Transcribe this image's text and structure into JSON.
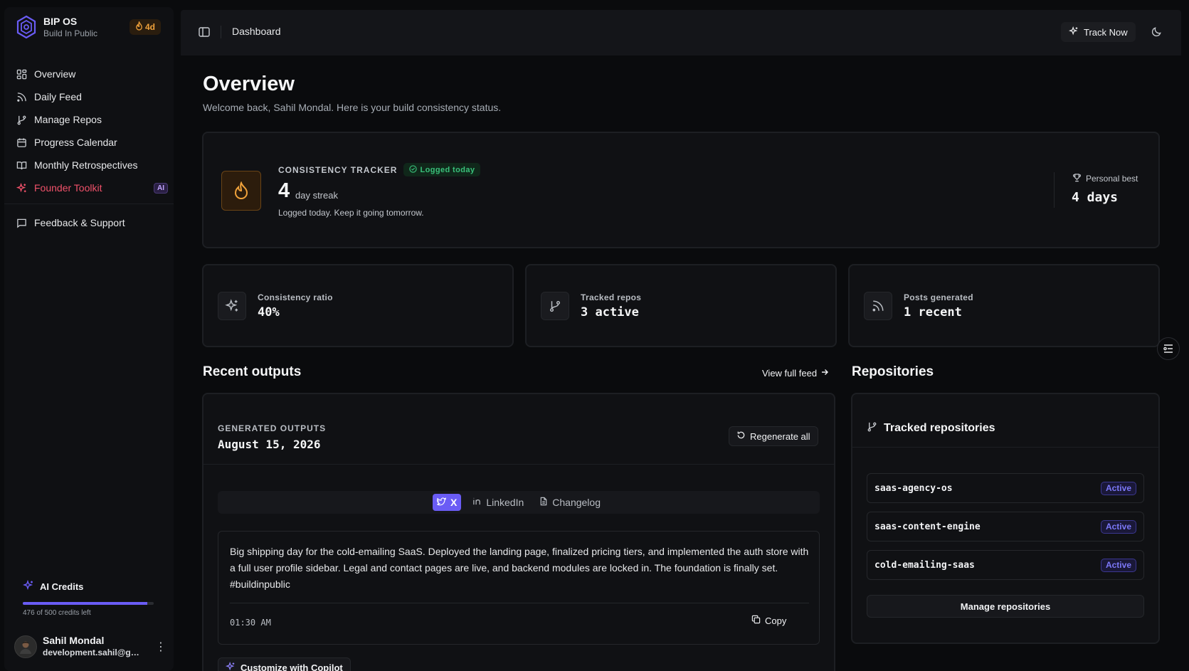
{
  "brand": {
    "name": "BIP OS",
    "subtitle": "Build In Public",
    "streak_badge": "4d"
  },
  "sidebar": {
    "items": [
      {
        "label": "Overview",
        "icon": "dashboard-icon"
      },
      {
        "label": "Daily Feed",
        "icon": "rss-icon"
      },
      {
        "label": "Manage Repos",
        "icon": "git-branch-icon"
      },
      {
        "label": "Progress Calendar",
        "icon": "calendar-icon"
      },
      {
        "label": "Monthly Retrospectives",
        "icon": "book-icon"
      },
      {
        "label": "Founder Toolkit",
        "icon": "sparkles-icon",
        "badge": "AI"
      }
    ],
    "secondary": [
      {
        "label": "Feedback & Support",
        "icon": "message-icon"
      }
    ],
    "credits": {
      "title": "AI Credits",
      "text": "476 of 500 credits left",
      "fraction": 0.952
    },
    "user": {
      "name": "Sahil Mondal",
      "email": "development.sahil@gmail.com"
    }
  },
  "header": {
    "title": "Dashboard",
    "track_now": "Track Now"
  },
  "main": {
    "title": "Overview",
    "subtitle": "Welcome back, Sahil Mondal. Here is your build consistency status."
  },
  "tracker": {
    "label": "CONSISTENCY TRACKER",
    "logged_pill": "Logged today",
    "streak_value": "4",
    "streak_unit": "day streak",
    "note": "Logged today. Keep it going tomorrow.",
    "personal_best_label": "Personal best",
    "personal_best_value": "4 days"
  },
  "stats": [
    {
      "label": "Consistency ratio",
      "value": "40%",
      "icon": "sparkles-icon"
    },
    {
      "label": "Tracked repos",
      "value": "3 active",
      "icon": "git-branch-icon"
    },
    {
      "label": "Posts generated",
      "value": "1 recent",
      "icon": "rss-icon"
    }
  ],
  "outputs": {
    "section_title": "Recent outputs",
    "view_link": "View full feed",
    "label": "GENERATED OUTPUTS",
    "date": "August 15, 2026",
    "regenerate": "Regenerate all",
    "tabs": [
      {
        "label": "X",
        "icon": "twitter-icon",
        "active": true
      },
      {
        "label": "LinkedIn",
        "icon": "linkedin-icon",
        "active": false
      },
      {
        "label": "Changelog",
        "icon": "file-icon",
        "active": false
      }
    ],
    "post_text": "Big shipping day for the cold-emailing SaaS. Deployed the landing page, finalized pricing tiers, and implemented the auth store with a full user profile sidebar. Legal and contact pages are live, and backend modules are locked in. The foundation is finally set. #buildinpublic",
    "post_time": "01:30 AM",
    "copy": "Copy",
    "copilot": "Customize with Copilot"
  },
  "repositories": {
    "section_title": "Repositories",
    "card_title": "Tracked repositories",
    "items": [
      {
        "name": "saas-agency-os",
        "status": "Active"
      },
      {
        "name": "saas-content-engine",
        "status": "Active"
      },
      {
        "name": "cold-emailing-saas",
        "status": "Active"
      }
    ],
    "manage": "Manage repositories"
  },
  "colors": {
    "accent": "#6a5cf5",
    "flame": "#f0a23b",
    "success": "#39c07a",
    "toolkit": "#f0516a"
  }
}
